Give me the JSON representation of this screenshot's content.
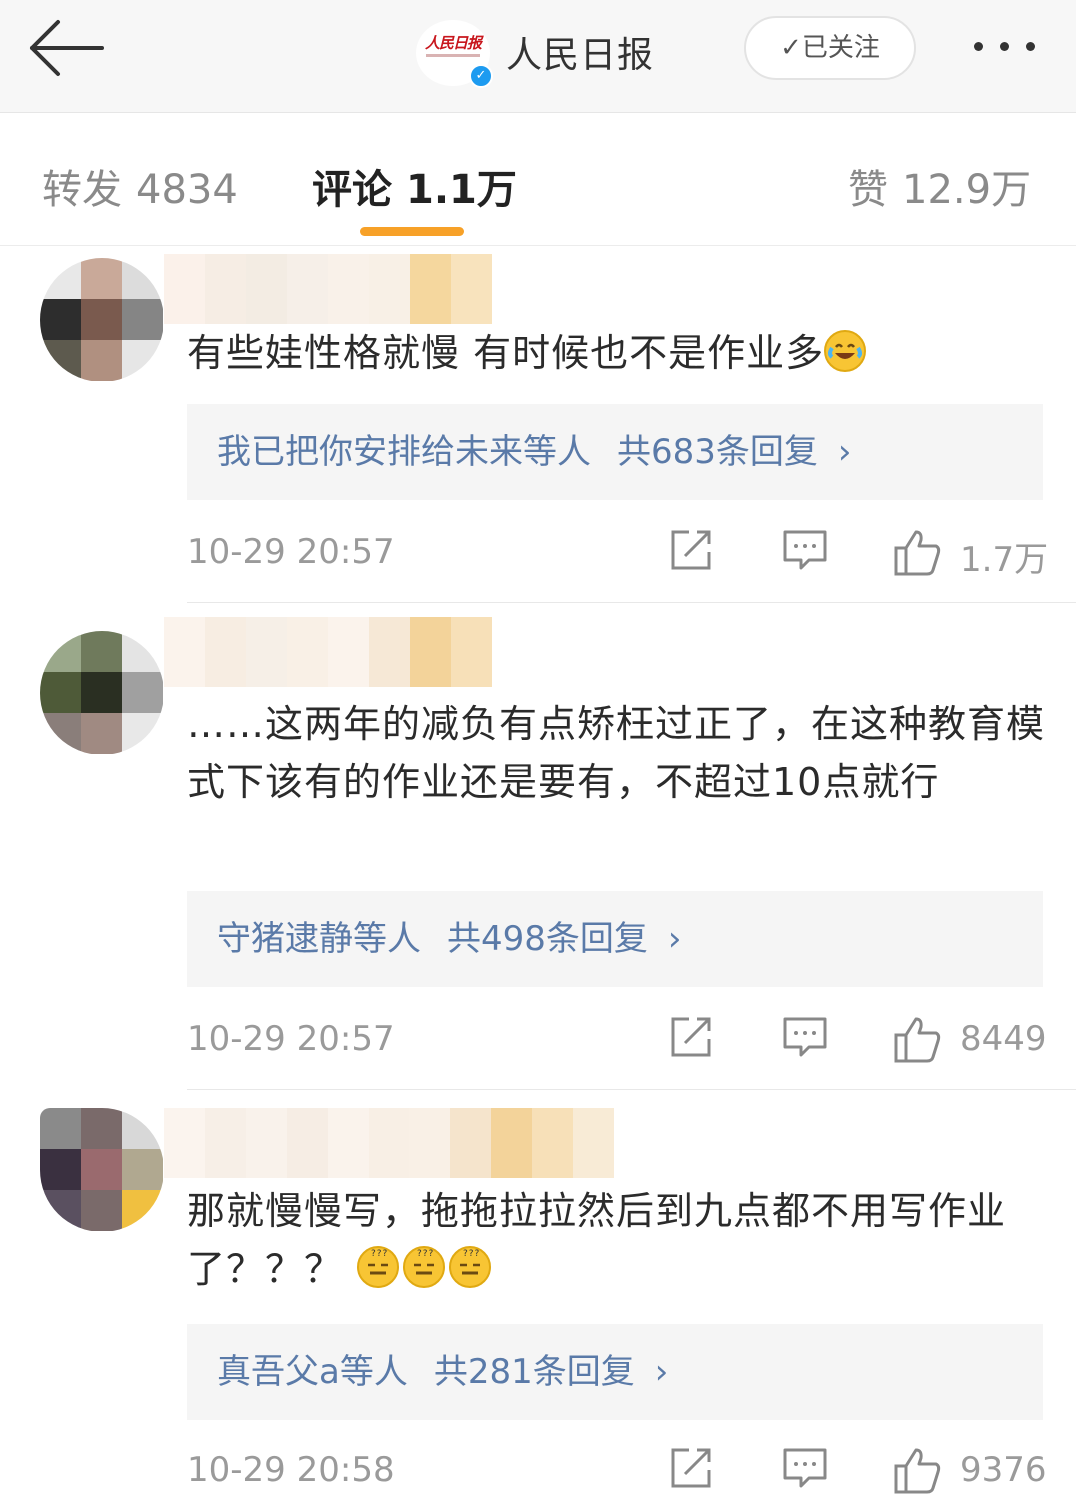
{
  "header": {
    "back_label": "←",
    "logo_text": "人民日报",
    "account_name": "人民日报",
    "follow_label": "✓已关注"
  },
  "tabs": {
    "repost_label": "转发",
    "repost_count": "4834",
    "comment_label": "评论",
    "comment_count": "1.1万",
    "like_label": "赞",
    "like_count": "12.9万",
    "accent": "#f7a128"
  },
  "comments": [
    {
      "text": "有些娃性格就慢 有时候也不是作业多",
      "emojis": [
        "laughing-crying"
      ],
      "reply_users": "我已把你安排给未来等人",
      "reply_count": "共683条回复",
      "time": "10-29 20:57",
      "likes": "1.7万"
    },
    {
      "text": "……这两年的减负有点矫枉过正了，在这种教育模式下该有的作业还是要有，不超过10点就行",
      "reply_users": "守猪逮静等人",
      "reply_count": "共498条回复",
      "time": "10-29 20:57",
      "likes": "8449"
    },
    {
      "text": "那就慢慢写，拖拖拉拉然后到九点都不用写作业了？？？",
      "emojis": [
        "dizzy-face",
        "dizzy-face",
        "dizzy-face"
      ],
      "reply_users": "真吾父a等人",
      "reply_count": "共281条回复",
      "time": "10-29 20:58",
      "likes": "9376"
    }
  ],
  "colors": {
    "link_blue": "#5a7aa8",
    "meta_gray": "#9a9a9a"
  }
}
